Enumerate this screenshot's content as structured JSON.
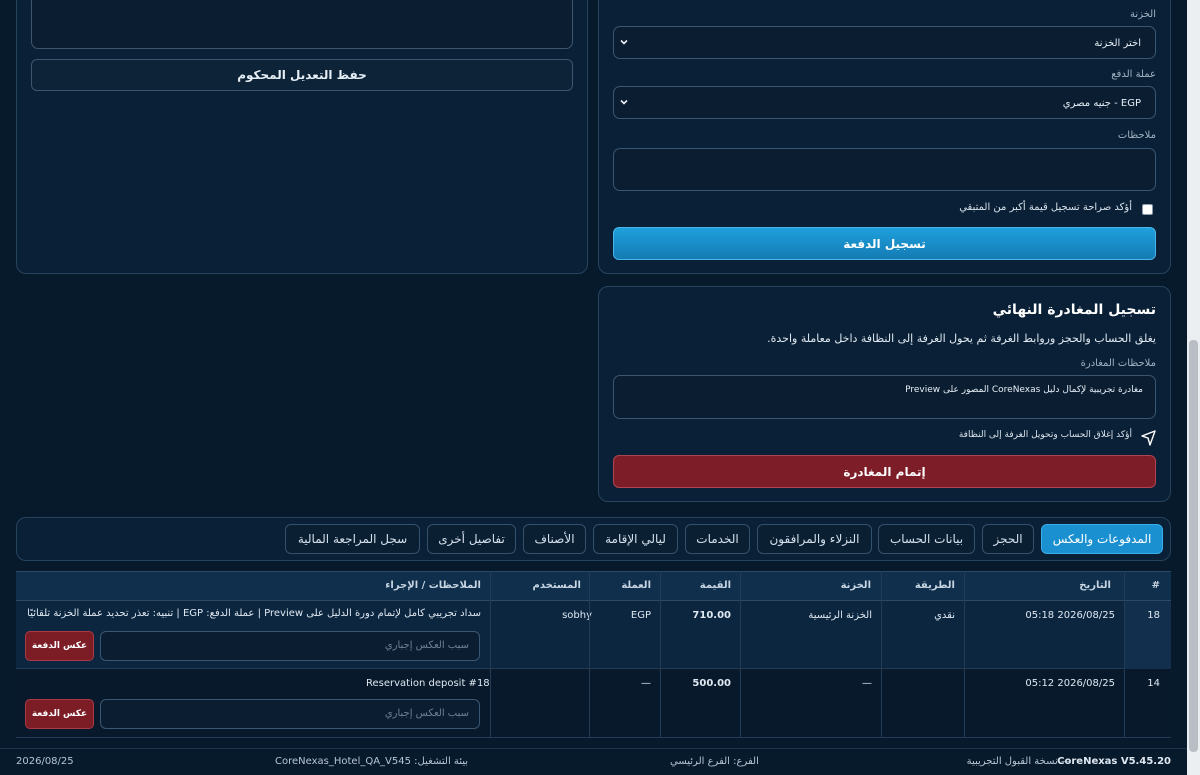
{
  "payment_form": {
    "treasury_label": "الخزنة",
    "treasury_value": "اختر الخزنة",
    "currency_label": "عملة الدفع",
    "currency_value": "EGP - جنيه مصري",
    "notes_label": "ملاحظات",
    "confirm_label": "أؤكد صراحة تسجيل قيمة أكبر من المتبقي",
    "submit_label": "تسجيل الدفعة"
  },
  "edit_card": {
    "save_label": "حفظ التعديل المحكوم"
  },
  "checkout": {
    "title": "تسجيل المغادرة النهائي",
    "description": "يغلق الحساب والحجز وروابط الغرفة ثم يحول الغرفة إلى النظافة داخل معاملة واحدة.",
    "notes_label": "ملاحظات المغادرة",
    "notes_value": "مغادرة تجريبية لإكمال دليل CoreNexas المصور على Preview",
    "confirm_label": "أؤكد إغلاق الحساب وتحويل الغرفة إلى النظافة",
    "submit_label": "إتمام المغادرة"
  },
  "tabs": [
    {
      "label": "المدفوعات والعكس",
      "active": true
    },
    {
      "label": "الحجز"
    },
    {
      "label": "بيانات الحساب"
    },
    {
      "label": "النزلاء والمرافقون"
    },
    {
      "label": "الخدمات"
    },
    {
      "label": "ليالي الإقامة"
    },
    {
      "label": "الأصناف"
    },
    {
      "label": "تفاصيل أخرى"
    },
    {
      "label": "سجل المراجعة المالية"
    }
  ],
  "table": {
    "headers": {
      "num": "#",
      "date": "التاريخ",
      "method": "الطريقة",
      "treasury": "الخزنة",
      "amount": "القيمة",
      "currency": "العملة",
      "user": "المستخدم",
      "notes": "الملاحظات / الإجراء"
    },
    "rows": [
      {
        "num": "18",
        "date": "2026/08/25 05:18",
        "method": "نقدي",
        "treasury": "الخزنة الرئيسية",
        "amount": "710.00",
        "currency": "EGP",
        "user": "sobhy",
        "notes": "سداد تجريبي كامل لإتمام دورة الدليل على Preview | عملة الدفع: EGP | تنبيه: تعذر تحديد عملة الخزنة تلقائيًا",
        "reason_placeholder": "سبب العكس إجباري",
        "reverse_label": "عكس الدفعة"
      },
      {
        "num": "14",
        "date": "2026/08/25 05:12",
        "method": "",
        "treasury": "—",
        "amount": "500.00",
        "currency": "—",
        "user": "",
        "notes": "Reservation deposit #18",
        "reason_placeholder": "سبب العكس إجباري",
        "reverse_label": "عكس الدفعة"
      }
    ]
  },
  "footer": {
    "brand": "CoreNexas V5.45.20",
    "edition": "— نسخة القبول التجريبية",
    "branch": "الفرع: الفرع الرئيسي",
    "environment": "بيئة التشغيل: CoreNexas_Hotel_QA_V545",
    "date": "2026/08/25"
  },
  "colors": {
    "background": "#071a2c",
    "primary_button": "#1a8fcf",
    "danger_button": "#7d1d27",
    "active_tab": "#1a90d0"
  }
}
